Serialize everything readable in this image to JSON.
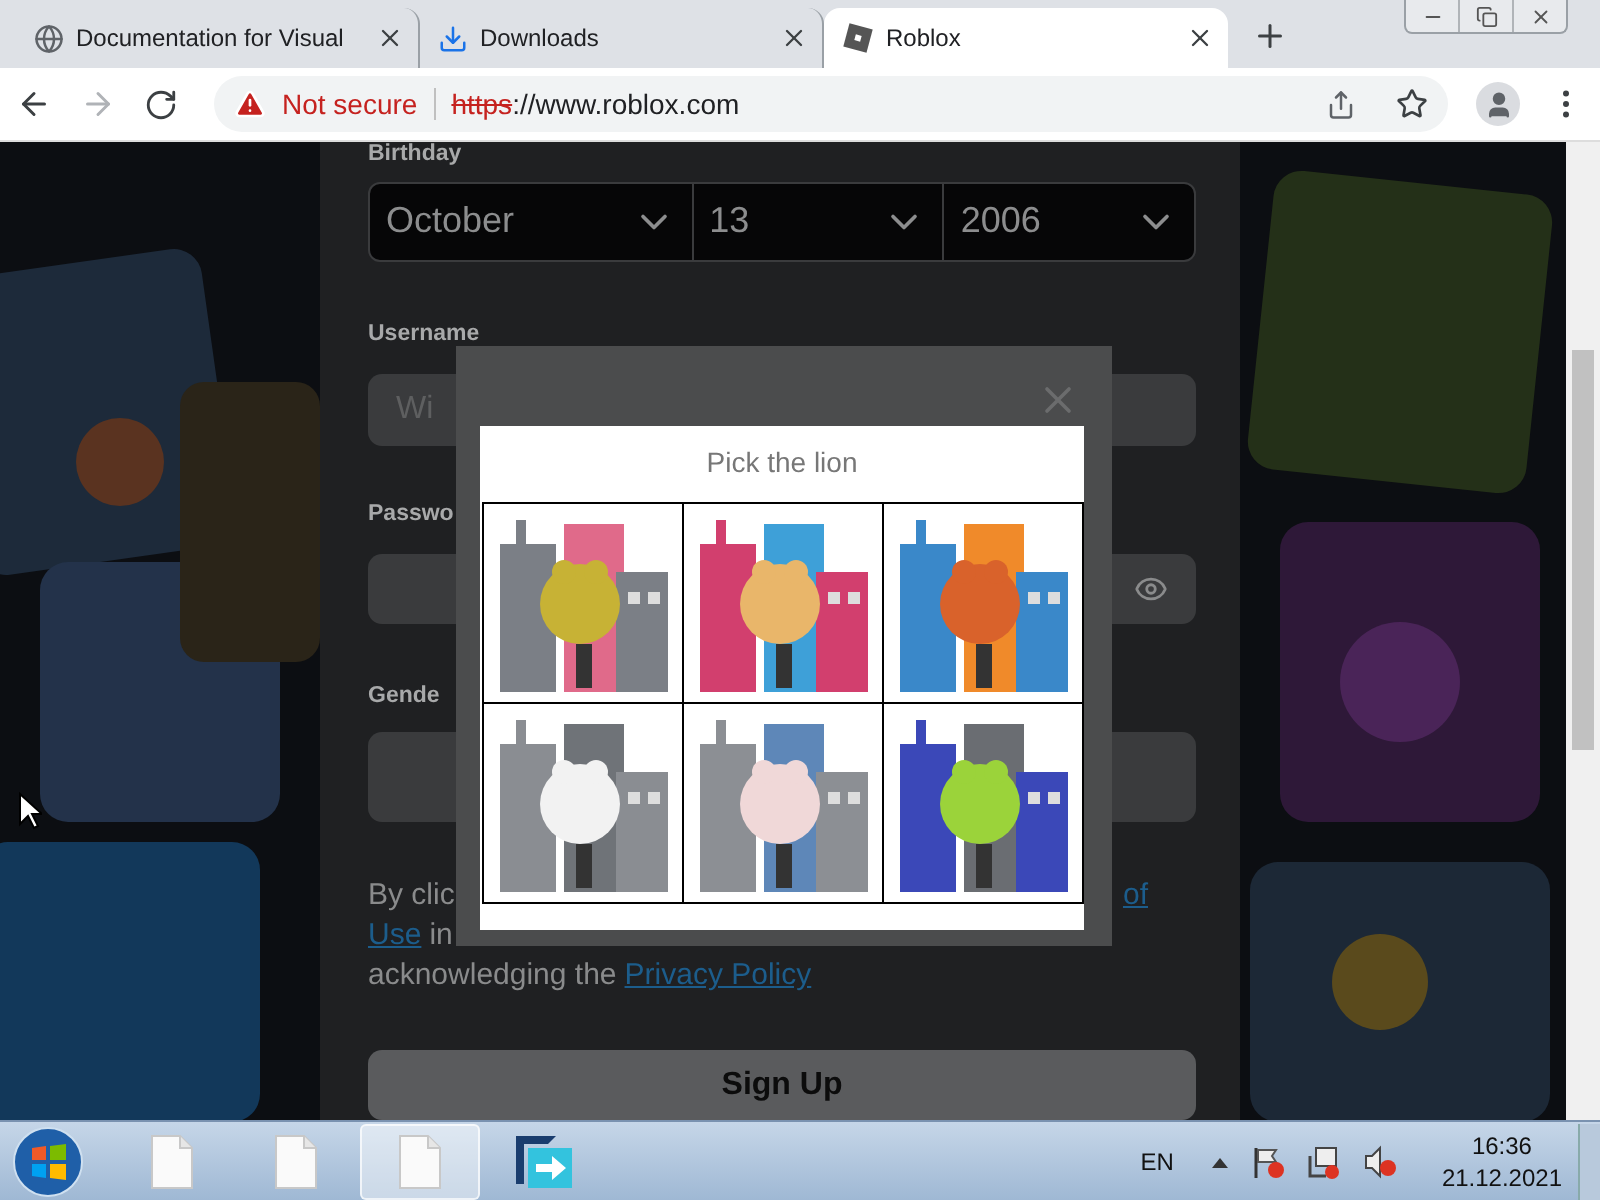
{
  "browser": {
    "tabs": [
      {
        "title": "Documentation for Visual",
        "kind": "globe",
        "selected": false
      },
      {
        "title": "Downloads",
        "kind": "download",
        "selected": false
      },
      {
        "title": "Roblox",
        "kind": "roblox",
        "selected": true
      }
    ],
    "forward": {
      "disabled": true
    },
    "address": {
      "security": "Not secure",
      "scheme": "https",
      "rest": "://www.roblox.com"
    }
  },
  "form": {
    "birthday": {
      "label": "Birthday",
      "month": "October",
      "day": "13",
      "year": "2006"
    },
    "username": {
      "label": "Username",
      "placeholder": "Wi"
    },
    "password": {
      "label": "Passwo"
    },
    "gender": {
      "label": "Gende"
    },
    "terms": {
      "start": "By clic",
      "link_end": "of",
      "link_start": "Use",
      "after_link": "in",
      "lead": "acknowledging the",
      "privacy": "Privacy Policy"
    },
    "signup": "Sign Up"
  },
  "captcha": {
    "prompt": "Pick the lion"
  },
  "taskbar": {
    "apps": [
      {
        "kind": "file",
        "selected": false
      },
      {
        "kind": "file",
        "selected": false
      },
      {
        "kind": "file",
        "selected": true
      },
      {
        "kind": "app",
        "selected": false
      }
    ],
    "language": "EN",
    "time": "16:36",
    "date": "21.12.2021"
  }
}
